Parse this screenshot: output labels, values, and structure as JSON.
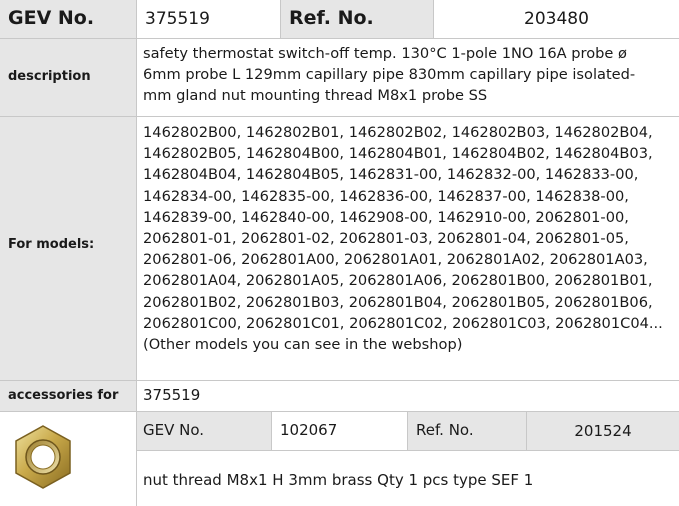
{
  "header": {
    "gev_label": "GEV No.",
    "gev_value": "375519",
    "ref_label": "Ref. No.",
    "ref_value": "203480"
  },
  "description": {
    "label": "description",
    "lines": [
      "safety thermostat  switch-off temp. 130°C 1-pole 1NO 16A probe ø",
      "6mm probe L 129mm capillary pipe 830mm capillary pipe isolated-",
      "mm gland nut mounting thread M8x1 probe SS"
    ]
  },
  "models": {
    "label": "For models:",
    "lines": [
      "1462802B00, 1462802B01, 1462802B02, 1462802B03, 1462802B04,",
      "1462802B05, 1462804B00, 1462804B01, 1462804B02, 1462804B03,",
      "1462804B04, 1462804B05, 1462831-00, 1462832-00, 1462833-00,",
      "1462834-00, 1462835-00, 1462836-00, 1462837-00, 1462838-00,",
      "1462839-00, 1462840-00, 1462908-00, 1462910-00, 2062801-00,",
      "2062801-01, 2062801-02, 2062801-03, 2062801-04, 2062801-05,",
      "2062801-06, 2062801A00, 2062801A01, 2062801A02, 2062801A03,",
      "2062801A04, 2062801A05, 2062801A06, 2062801B00, 2062801B01,",
      "2062801B02, 2062801B03, 2062801B04, 2062801B05, 2062801B06,",
      "2062801C00, 2062801C01, 2062801C02, 2062801C03, 2062801C04...",
      "(Other models you can see in the webshop)"
    ]
  },
  "accessories": {
    "label": "accessories for",
    "value": "375519"
  },
  "accessory_item": {
    "image_icon": "hex-nut-icon",
    "gev_label": "GEV No.",
    "gev_value": "102067",
    "ref_label": "Ref. No.",
    "ref_value": "201524",
    "description": "nut  thread M8x1 H 3mm brass Qty 1 pcs type SEF 1"
  }
}
